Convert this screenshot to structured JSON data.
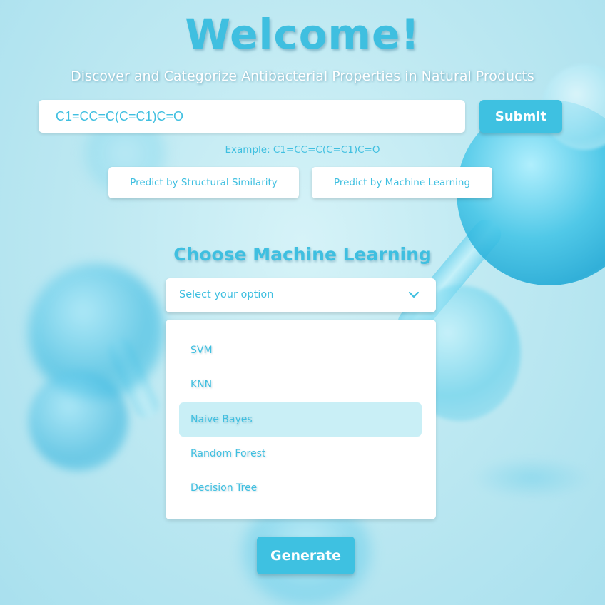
{
  "header": {
    "title": "Welcome!",
    "subtitle": "Discover and Categorize Antibacterial Properties in Natural Products"
  },
  "smiles": {
    "value": "C1=CC=C(C=C1)C=O",
    "submit_label": "Submit",
    "example": "Example: C1=CC=C(C=C1)C=O"
  },
  "modes": {
    "similarity_label": "Predict by Structural Similarity",
    "ml_label": "Predict by Machine Learning"
  },
  "ml": {
    "title": "Choose Machine Learning",
    "select_placeholder": "Select your option",
    "options": [
      "SVM",
      "KNN",
      "Naive Bayes",
      "Random Forest",
      "Decision Tree"
    ],
    "highlighted_option": "Naive Bayes",
    "generate_label": "Generate"
  },
  "colors": {
    "accent": "#3fbfe0",
    "button": "#3ec1e1",
    "highlight": "#c9eff6"
  },
  "icons": {
    "dropdown": "chevron-down-icon"
  }
}
